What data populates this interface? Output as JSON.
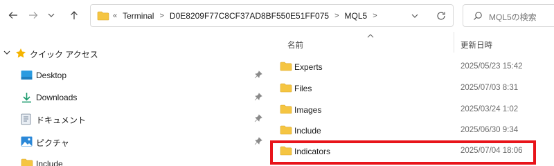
{
  "navbar": {
    "back_icon": "arrow-left-icon",
    "forward_icon": "arrow-right-icon",
    "recent_icon": "chevron-down-icon",
    "up_icon": "arrow-up-icon",
    "breadcrumb_lead": "«",
    "breadcrumb": [
      "Terminal",
      "D0E8209F77C8CF37AD8BF550E51FF075",
      "MQL5"
    ],
    "search_placeholder": "MQL5の検索"
  },
  "navpane": {
    "quick_access_label": "クイック アクセス",
    "items": [
      {
        "label": "Desktop",
        "icon": "desktop-icon",
        "pinned": true
      },
      {
        "label": "Downloads",
        "icon": "download-icon",
        "pinned": true
      },
      {
        "label": "ドキュメント",
        "icon": "document-icon",
        "pinned": true
      },
      {
        "label": "ピクチャ",
        "icon": "picture-icon",
        "pinned": true
      },
      {
        "label": "Include",
        "icon": "folder-icon",
        "pinned": false
      }
    ]
  },
  "filelist": {
    "columns": {
      "name": "名前",
      "date": "更新日時"
    },
    "rows": [
      {
        "name": "Experts",
        "date": "2025/05/23 15:42"
      },
      {
        "name": "Files",
        "date": "2025/07/03 8:31"
      },
      {
        "name": "Images",
        "date": "2025/03/24 1:02"
      },
      {
        "name": "Include",
        "date": "2025/06/30 9:34"
      },
      {
        "name": "Indicators",
        "date": "2025/07/04 18:06",
        "highlighted": true
      }
    ]
  },
  "colors": {
    "folder": "#f5c542",
    "highlight": "#e8141a",
    "pin": "#8a8a8a"
  }
}
